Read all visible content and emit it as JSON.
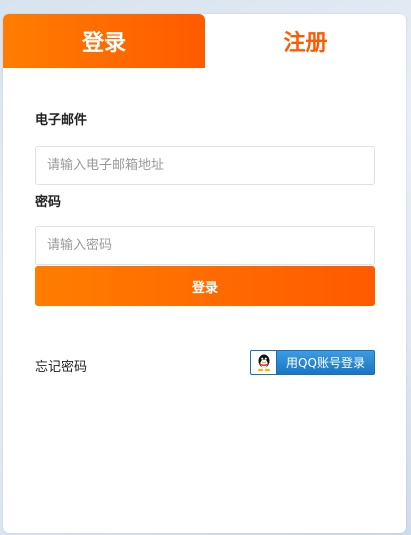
{
  "tabs": {
    "login": "登录",
    "register": "注册"
  },
  "form": {
    "email_label": "电子邮件",
    "email_placeholder": "请输入电子邮箱地址",
    "password_label": "密码",
    "password_placeholder": "请输入密码",
    "submit_label": "登录",
    "forgot_label": "忘记密码",
    "qq_login_label": "用QQ账号登录"
  },
  "colors": {
    "accent": "#ff6a00",
    "qq_blue": "#1877c4"
  },
  "icons": {
    "qq": "qq-penguin-icon"
  }
}
